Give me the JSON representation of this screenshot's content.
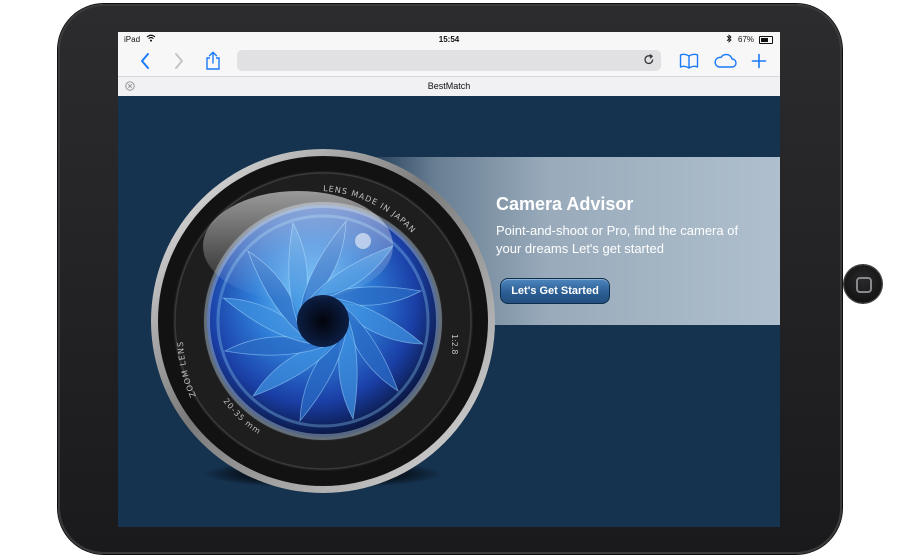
{
  "status_bar": {
    "carrier": "iPad",
    "wifi_icon": "wifi-icon",
    "time": "15:54",
    "bluetooth_icon": "bluetooth-icon",
    "battery_percent": "67%",
    "battery_level": 0.67
  },
  "toolbar": {
    "back_icon": "chevron-left-icon",
    "forward_icon": "chevron-right-icon",
    "share_icon": "share-icon",
    "url": "",
    "reload_icon": "reload-icon",
    "reader_icon": "book-icon",
    "cloud_icon": "cloud-icon",
    "new_tab_icon": "plus-icon",
    "accent_color": "#1a7af8"
  },
  "tab": {
    "title": "BestMatch",
    "close_icon": "close-icon"
  },
  "page": {
    "background_color": "#15324f",
    "hero_title": "Camera Advisor",
    "hero_text": "Point-and-shoot or Pro, find the camera of your dreams Let's get started",
    "cta_label": "Let's Get Started",
    "lens_text_top": "LENS MADE IN JAPAN",
    "lens_text_left": "ZOOM LENS",
    "lens_text_bottom": "20-35 mm",
    "lens_text_right": "1:2.8"
  }
}
